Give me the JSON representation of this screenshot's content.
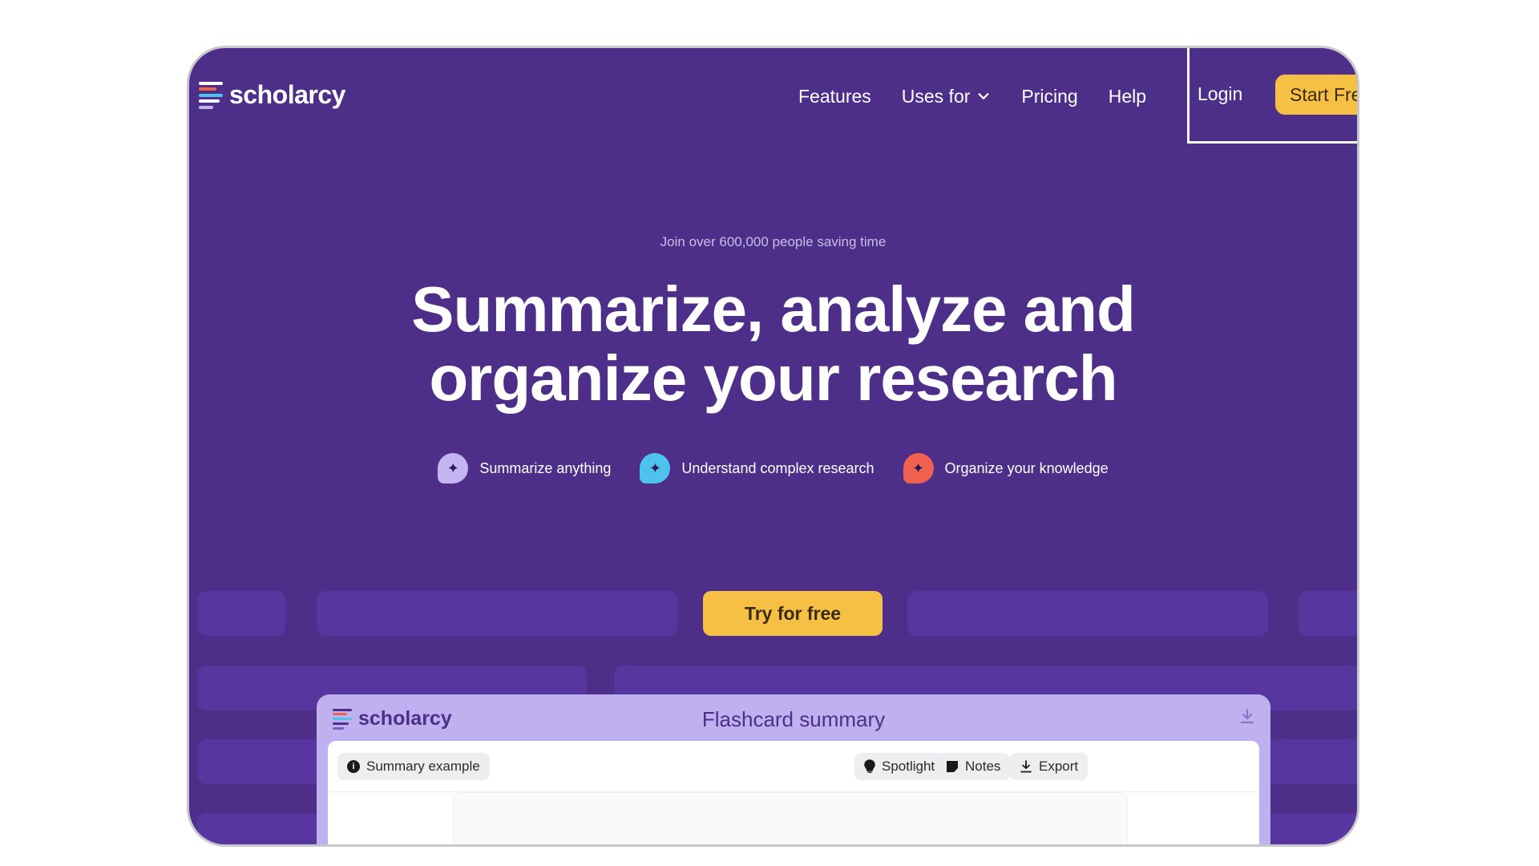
{
  "nav": {
    "logo_text": "scholarcy",
    "links": [
      "Features",
      "Uses for",
      "Pricing",
      "Help"
    ],
    "login": "Login",
    "cta": "Start Fre"
  },
  "hero": {
    "tagline": "Join over 600,000 people saving time",
    "headline_line1": "Summarize, analyze and",
    "headline_line2": "organize your research",
    "features": [
      {
        "label": "Summarize anything",
        "color": "#c3b4f2"
      },
      {
        "label": "Understand complex research",
        "color": "#4fc3f0"
      },
      {
        "label": "Organize your knowledge",
        "color": "#f0624f"
      }
    ],
    "cta": "Try for free"
  },
  "card": {
    "logo_text": "scholarcy",
    "title": "Flashcard summary",
    "summary_chip": "Summary example",
    "actions": [
      "Spotlight",
      "Notes",
      "Export"
    ]
  },
  "colors": {
    "background": "#4d2f8a",
    "accent": "#f5c044"
  }
}
